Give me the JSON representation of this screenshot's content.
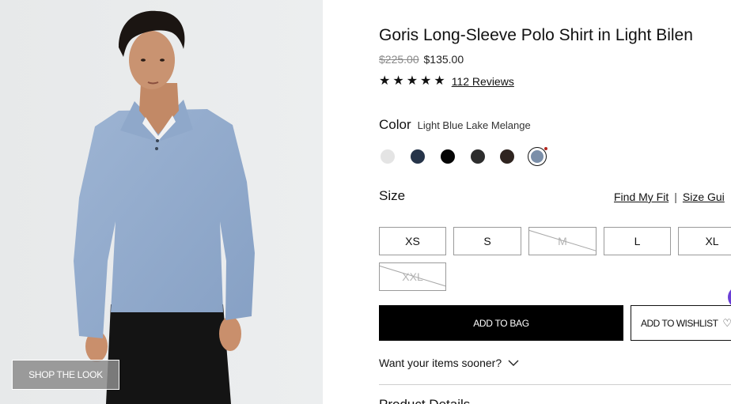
{
  "image": {
    "alt": "",
    "shop_the_look_label": "SHOP THE LOOK"
  },
  "product": {
    "title": "Goris Long-Sleeve Polo Shirt in Light Bilen",
    "price_original": "$225.00",
    "price_sale": "$135.00",
    "rating_stars": 5,
    "reviews_label": "112 Reviews"
  },
  "color": {
    "label": "Color",
    "selected_name": "Light Blue Lake Melange",
    "swatches": [
      {
        "name": "light-grey",
        "hex": "#e4e4e4"
      },
      {
        "name": "navy",
        "hex": "#263449"
      },
      {
        "name": "black",
        "hex": "#050505"
      },
      {
        "name": "charcoal",
        "hex": "#2d2d2d"
      },
      {
        "name": "dark-brown",
        "hex": "#2f2420"
      },
      {
        "name": "light-blue-lake-melange",
        "hex": "#7b8fa9",
        "selected": true
      }
    ]
  },
  "size": {
    "label": "Size",
    "find_fit_label": "Find My Fit",
    "guide_label": "Size Gui",
    "options": [
      {
        "label": "XS",
        "available": true
      },
      {
        "label": "S",
        "available": true
      },
      {
        "label": "M",
        "available": false
      },
      {
        "label": "L",
        "available": true
      },
      {
        "label": "XL",
        "available": true
      },
      {
        "label": "XXL",
        "available": false
      }
    ]
  },
  "actions": {
    "add_to_bag": "ADD TO BAG",
    "add_to_wishlist": "ADD TO WISHLIST",
    "heart_icon": "heart-outline-icon"
  },
  "delivery": {
    "sooner_label": "Want your items sooner?"
  },
  "sections": {
    "product_details": "Product Details"
  },
  "colors": {
    "accent_chat": "#6b3fd6",
    "primary_button": "#000000",
    "new_dot": "#b3261e"
  }
}
